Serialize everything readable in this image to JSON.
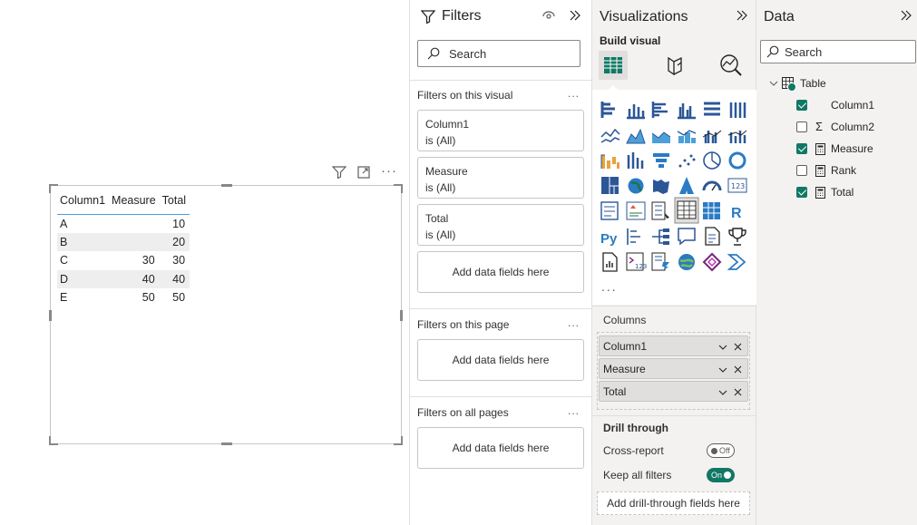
{
  "table_visual": {
    "headers": [
      "Column1",
      "Measure",
      "Total"
    ],
    "rows": [
      {
        "col1": "A",
        "measure": "",
        "total": "10"
      },
      {
        "col1": "B",
        "measure": "",
        "total": "20"
      },
      {
        "col1": "C",
        "measure": "30",
        "total": "30"
      },
      {
        "col1": "D",
        "measure": "40",
        "total": "40"
      },
      {
        "col1": "E",
        "measure": "50",
        "total": "50"
      }
    ]
  },
  "filters": {
    "title": "Filters",
    "search_placeholder": "Search",
    "on_visual_label": "Filters on this visual",
    "cards": [
      {
        "name": "Column1",
        "state": "is (All)"
      },
      {
        "name": "Measure",
        "state": "is (All)"
      },
      {
        "name": "Total",
        "state": "is (All)"
      }
    ],
    "add_fields": "Add data fields here",
    "on_page_label": "Filters on this page",
    "on_all_label": "Filters on all pages",
    "more": "..."
  },
  "visualizations": {
    "title": "Visualizations",
    "build_visual": "Build visual",
    "more": "...",
    "columns_label": "Columns",
    "columns": [
      "Column1",
      "Measure",
      "Total"
    ],
    "drill_through": "Drill through",
    "cross_report": "Cross-report",
    "cross_report_state": "Off",
    "keep_all_filters": "Keep all filters",
    "keep_all_filters_state": "On",
    "add_drill": "Add drill-through fields here",
    "accent": "#117865",
    "r_label": "R",
    "py_label": "Py"
  },
  "data": {
    "title": "Data",
    "search_placeholder": "Search",
    "table_name": "Table",
    "fields": [
      {
        "name": "Column1",
        "checked": true,
        "icon": "none"
      },
      {
        "name": "Column2",
        "checked": false,
        "icon": "sigma"
      },
      {
        "name": "Measure",
        "checked": true,
        "icon": "calculator"
      },
      {
        "name": "Rank",
        "checked": false,
        "icon": "calculator"
      },
      {
        "name": "Total",
        "checked": true,
        "icon": "calculator"
      }
    ]
  }
}
